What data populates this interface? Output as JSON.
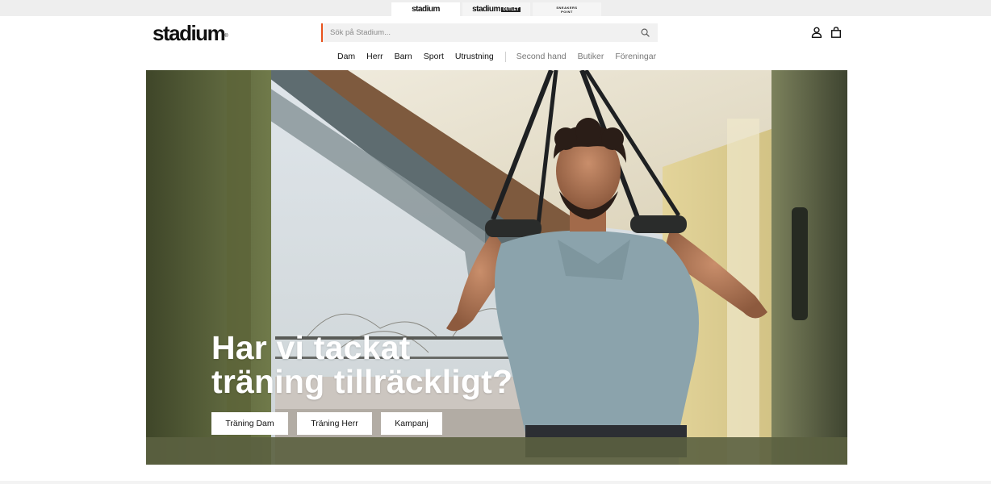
{
  "brand_switcher": {
    "tabs": [
      {
        "label": "stadium"
      },
      {
        "label": "stadium",
        "tag": "OUTLET"
      },
      {
        "label_line1": "SNEAKERS",
        "label_line2": "POINT"
      }
    ]
  },
  "header": {
    "logo_text": "stadium",
    "logo_mark": "®",
    "search": {
      "placeholder": "Sök på Stadium...",
      "value": ""
    },
    "icons": [
      "search-icon",
      "account-icon",
      "shopping-bag-icon"
    ]
  },
  "nav": {
    "primary": [
      "Dam",
      "Herr",
      "Barn",
      "Sport",
      "Utrustning"
    ],
    "secondary": [
      "Second hand",
      "Butiker",
      "Föreningar"
    ]
  },
  "hero": {
    "title_line1": "Har vi tackat",
    "title_line2": "träning tillräckligt?",
    "buttons": [
      "Träning Dam",
      "Träning Herr",
      "Kampanj"
    ]
  },
  "colors": {
    "accent": "#e8521c",
    "search_bg": "#f1f1f1",
    "brandbar_bg": "#eeeeee",
    "text": "#111111",
    "muted_text": "#777777"
  }
}
